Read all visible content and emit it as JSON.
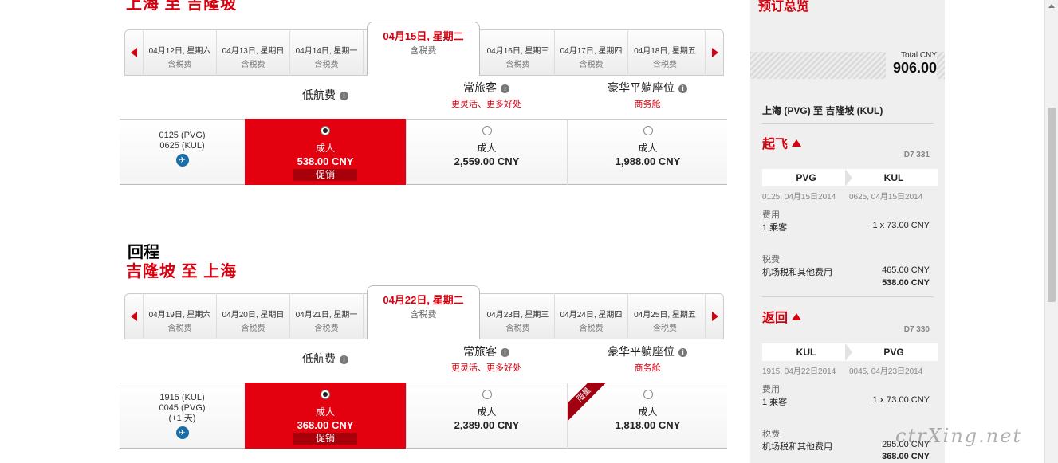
{
  "outbound": {
    "heading": "",
    "route_title": "上海 至 吉隆坡",
    "dates": [
      {
        "date": "04月12日, 星期六",
        "tax": "含税费"
      },
      {
        "date": "04月13日, 星期日",
        "tax": "含税费"
      },
      {
        "date": "04月14日, 星期一",
        "tax": "含税费"
      },
      {
        "date": "04月15日, 星期二",
        "tax": "含税费",
        "selected": true
      },
      {
        "date": "04月16日, 星期三",
        "tax": "含税费"
      },
      {
        "date": "04月17日, 星期四",
        "tax": "含税费"
      },
      {
        "date": "04月18日, 星期五",
        "tax": "含税费"
      }
    ],
    "fare_headers": [
      {
        "name": "低航费",
        "sub": ""
      },
      {
        "name": "常旅客",
        "sub": "更灵活、更多好处"
      },
      {
        "name": "豪华平躺座位",
        "sub": "商务舱"
      }
    ],
    "flight": {
      "depart": "0125  (PVG)",
      "arrive": "0625  (KUL)",
      "extra": ""
    },
    "fares": [
      {
        "pax": "成人",
        "amount": "538.00 CNY",
        "promo": "促销",
        "selected": true
      },
      {
        "pax": "成人",
        "amount": "2,559.00 CNY"
      },
      {
        "pax": "成人",
        "amount": "1,988.00 CNY"
      }
    ]
  },
  "return": {
    "heading": "回程",
    "route_title": "吉隆坡 至 上海",
    "dates": [
      {
        "date": "04月19日, 星期六",
        "tax": "含税费"
      },
      {
        "date": "04月20日, 星期日",
        "tax": "含税费"
      },
      {
        "date": "04月21日, 星期一",
        "tax": "含税费"
      },
      {
        "date": "04月22日, 星期二",
        "tax": "含税费",
        "selected": true
      },
      {
        "date": "04月23日, 星期三",
        "tax": "含税费"
      },
      {
        "date": "04月24日, 星期四",
        "tax": "含税费"
      },
      {
        "date": "04月25日, 星期五",
        "tax": "含税费"
      }
    ],
    "fare_headers": [
      {
        "name": "低航费",
        "sub": ""
      },
      {
        "name": "常旅客",
        "sub": "更灵活、更多好处"
      },
      {
        "name": "豪华平躺座位",
        "sub": "商务舱"
      }
    ],
    "flight": {
      "depart": "1915  (KUL)",
      "arrive": "0045  (PVG)",
      "extra": "(+1 天)"
    },
    "fares": [
      {
        "pax": "成人",
        "amount": "368.00 CNY",
        "promo": "促销",
        "selected": true
      },
      {
        "pax": "成人",
        "amount": "2,389.00 CNY"
      },
      {
        "pax": "成人",
        "amount": "1,818.00 CNY",
        "ribbon": "限量"
      }
    ]
  },
  "summary": {
    "title": "预订总览",
    "total_label": "Total CNY",
    "total_value": "906.00",
    "route": "上海 (PVG) 至 吉隆坡 (KUL)",
    "legs": [
      {
        "title": "起飞",
        "flight_no": "D7 331",
        "from": "PVG",
        "to": "KUL",
        "depart_time": "0125, 04月15日2014",
        "arrive_time": "0625, 04月15日2014",
        "fee_label": "费用",
        "pax_label": "1 乘客",
        "pax_fee": "1 x 73.00 CNY",
        "tax_label": "税费",
        "tax_item": "机场税和其他费用",
        "tax_value": "465.00 CNY",
        "subtotal": "538.00 CNY"
      },
      {
        "title": "返回",
        "flight_no": "D7 330",
        "from": "KUL",
        "to": "PVG",
        "depart_time": "1915, 04月22日2014",
        "arrive_time": "0045, 04月23日2014",
        "fee_label": "费用",
        "pax_label": "1 乘客",
        "pax_fee": "1 x 73.00 CNY",
        "tax_label": "税费",
        "tax_item": "机场税和其他费用",
        "tax_value": "295.00 CNY",
        "subtotal": "368.00 CNY"
      }
    ]
  },
  "watermark": "ctrXing.net",
  "colors": {
    "brand_red": "#e3000f",
    "promo_dark": "#a7000a",
    "panel_bg": "#efefef"
  }
}
